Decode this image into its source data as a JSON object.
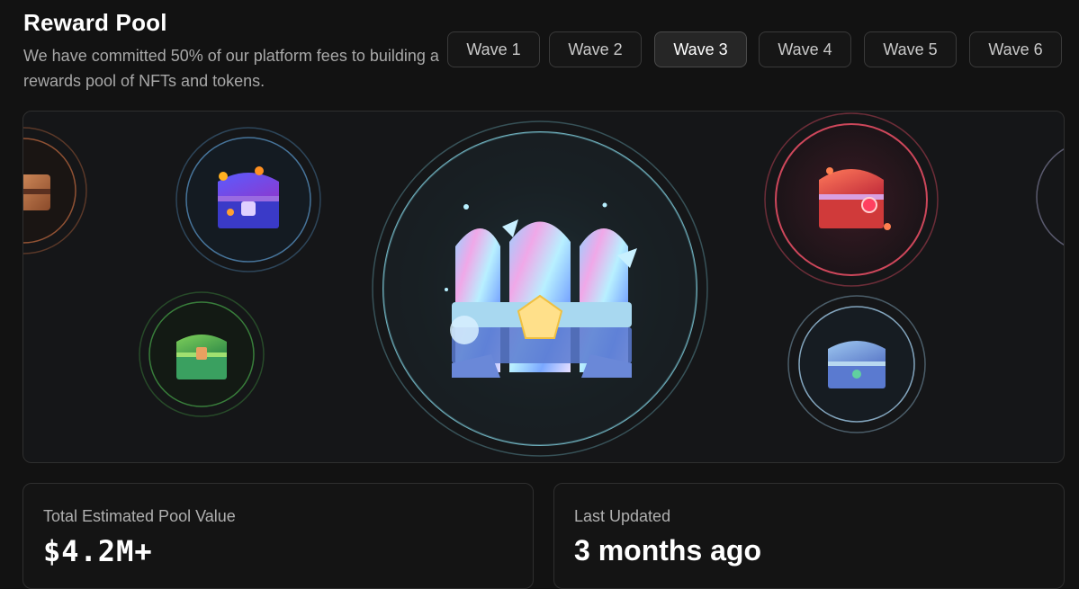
{
  "header": {
    "title": "Reward Pool",
    "subtitle": "We have committed 50% of our platform fees to building a rewards pool of NFTs and tokens."
  },
  "tabs": [
    {
      "label": "Wave 1",
      "active": false
    },
    {
      "label": "Wave 2",
      "active": false
    },
    {
      "label": "Wave 3",
      "active": true
    },
    {
      "label": "Wave 4",
      "active": false
    },
    {
      "label": "Wave 5",
      "active": false
    },
    {
      "label": "Wave 6",
      "active": false
    }
  ],
  "stats": {
    "pool_value_label": "Total Estimated Pool Value",
    "pool_value": "$4.2M+",
    "updated_label": "Last Updated",
    "updated_value": "3 months ago"
  },
  "colors": {
    "background": "#121212",
    "ring_blue": "#4c7ea8",
    "ring_green": "#3d8a3f",
    "ring_teal": "#79c2d0",
    "ring_red": "#d84a5f",
    "ring_orange": "#b0623c",
    "ring_lilac": "#8888a8"
  },
  "chests": [
    {
      "icon": "orange-chest-icon",
      "ring_color": "#b0623c"
    },
    {
      "icon": "purple-chest-icon",
      "ring_color": "#4c7ea8"
    },
    {
      "icon": "green-chest-icon",
      "ring_color": "#3d8a3f"
    },
    {
      "icon": "holographic-chest-icon",
      "ring_color": "#79c2d0"
    },
    {
      "icon": "red-chest-icon",
      "ring_color": "#d84a5f"
    },
    {
      "icon": "blue-chest-icon",
      "ring_color": "#8fb5cf"
    },
    {
      "icon": "lilac-chest-icon",
      "ring_color": "#8888a8"
    }
  ]
}
